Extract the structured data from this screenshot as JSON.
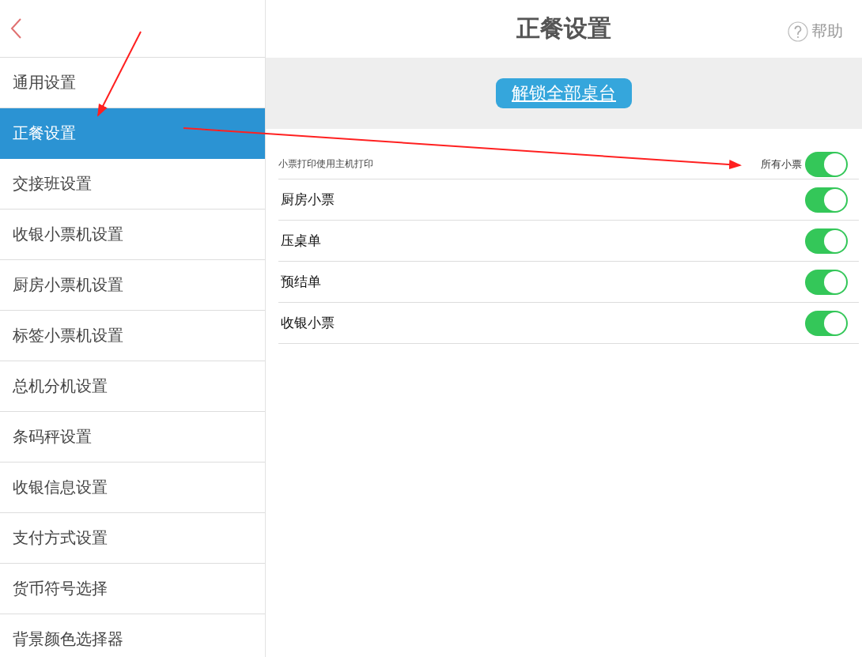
{
  "sidebar": {
    "items": [
      {
        "label": "通用设置",
        "selected": false
      },
      {
        "label": "正餐设置",
        "selected": true
      },
      {
        "label": "交接班设置",
        "selected": false
      },
      {
        "label": "收银小票机设置",
        "selected": false
      },
      {
        "label": "厨房小票机设置",
        "selected": false
      },
      {
        "label": "标签小票机设置",
        "selected": false
      },
      {
        "label": "总机分机设置",
        "selected": false
      },
      {
        "label": "条码秤设置",
        "selected": false
      },
      {
        "label": "收银信息设置",
        "selected": false
      },
      {
        "label": "支付方式设置",
        "selected": false
      },
      {
        "label": "货币符号选择",
        "selected": false
      },
      {
        "label": "背景颜色选择器",
        "selected": false
      }
    ]
  },
  "header": {
    "title": "正餐设置",
    "help": "帮助"
  },
  "unlock_button": "解锁全部桌台",
  "print_setting": {
    "label": "小票打印使用主机打印",
    "option": "所有小票",
    "on": true
  },
  "toggles": [
    {
      "label": "厨房小票",
      "on": true
    },
    {
      "label": "压桌单",
      "on": true
    },
    {
      "label": "预结单",
      "on": true
    },
    {
      "label": "收银小票",
      "on": true
    }
  ]
}
